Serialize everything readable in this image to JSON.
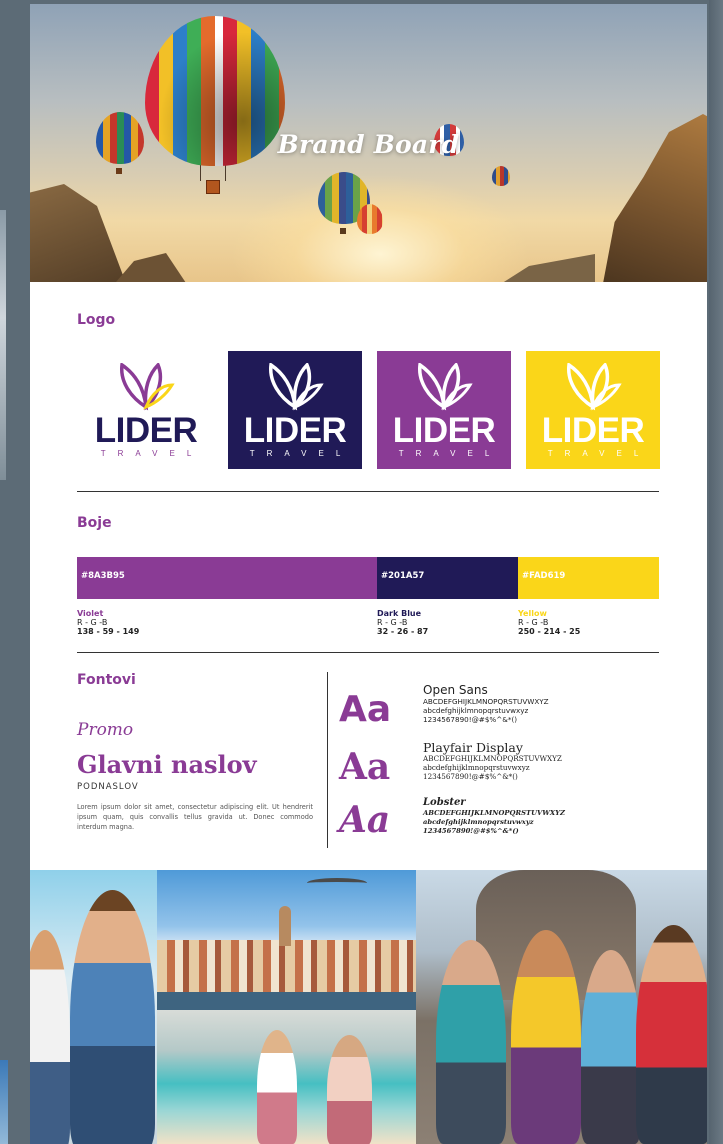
{
  "hero": {
    "title": "Brand Board"
  },
  "sections": {
    "logo": "Logo",
    "colors": "Boje",
    "fonts": "Fontovi"
  },
  "logo": {
    "wordmark": "LIDER",
    "subtitle": "TRAVEL",
    "variants": [
      {
        "background": "#ffffff",
        "text_color": "#201A57",
        "mark_color": "#8A3B95",
        "accent": "#FAD619"
      },
      {
        "background": "#201A57",
        "text_color": "#ffffff",
        "mark_color": "#ffffff",
        "accent": "#ffffff"
      },
      {
        "background": "#8A3B95",
        "text_color": "#ffffff",
        "mark_color": "#ffffff",
        "accent": "#ffffff"
      },
      {
        "background": "#FAD619",
        "text_color": "#ffffff",
        "mark_color": "#ffffff",
        "accent": "#ffffff"
      }
    ]
  },
  "colors": [
    {
      "hex": "#8A3B95",
      "name": "Violet",
      "label": "R - G -B",
      "values": "138 - 59 - 149",
      "name_color": "#8A3B95"
    },
    {
      "hex": "#201A57",
      "name": "Dark Blue",
      "label": "R - G -B",
      "values": "32 - 26 - 87",
      "name_color": "#201A57"
    },
    {
      "hex": "#FAD619",
      "name": "Yellow",
      "label": "R - G -B",
      "values": "250 - 214 - 25",
      "name_color": "#FAD619"
    }
  ],
  "typography": {
    "promo": "Promo",
    "heading": "Glavni naslov",
    "subheading": "PODNASLOV",
    "body": "Lorem ipsum dolor sit amet, consectetur adipiscing elit. Ut hendrerit ipsum quam, quis convallis tellus gravida ut. Donec commodo interdum magna.",
    "samples": [
      "Aa",
      "Aa",
      "Aa"
    ],
    "specimens": [
      {
        "name": "Open Sans",
        "upper": "ABCDEFGHIJKLMNOPQRSTUVWXYZ",
        "lower": "abcdefghijklmnopqrstuvwxyz",
        "digits": "1234567890!@#$%^&*()"
      },
      {
        "name": "Playfair Display",
        "upper": "ABCDEFGHIJKLMNOPQRSTUVWXYZ",
        "lower": "abcdefghijklmnopqrstuvwxyz",
        "digits": "1234567890!@#$%^&*()"
      },
      {
        "name": "Lobster",
        "upper": "ABCDEFGHIJKLMNOPQRSTUVWXYZ",
        "lower": "abcdefghijklmnopqrstuvwxyz",
        "digits": "1234567890!@#$%^&*()"
      }
    ]
  },
  "theme": {
    "violet": "#8A3B95",
    "dark_blue": "#201A57",
    "yellow": "#FAD619"
  }
}
